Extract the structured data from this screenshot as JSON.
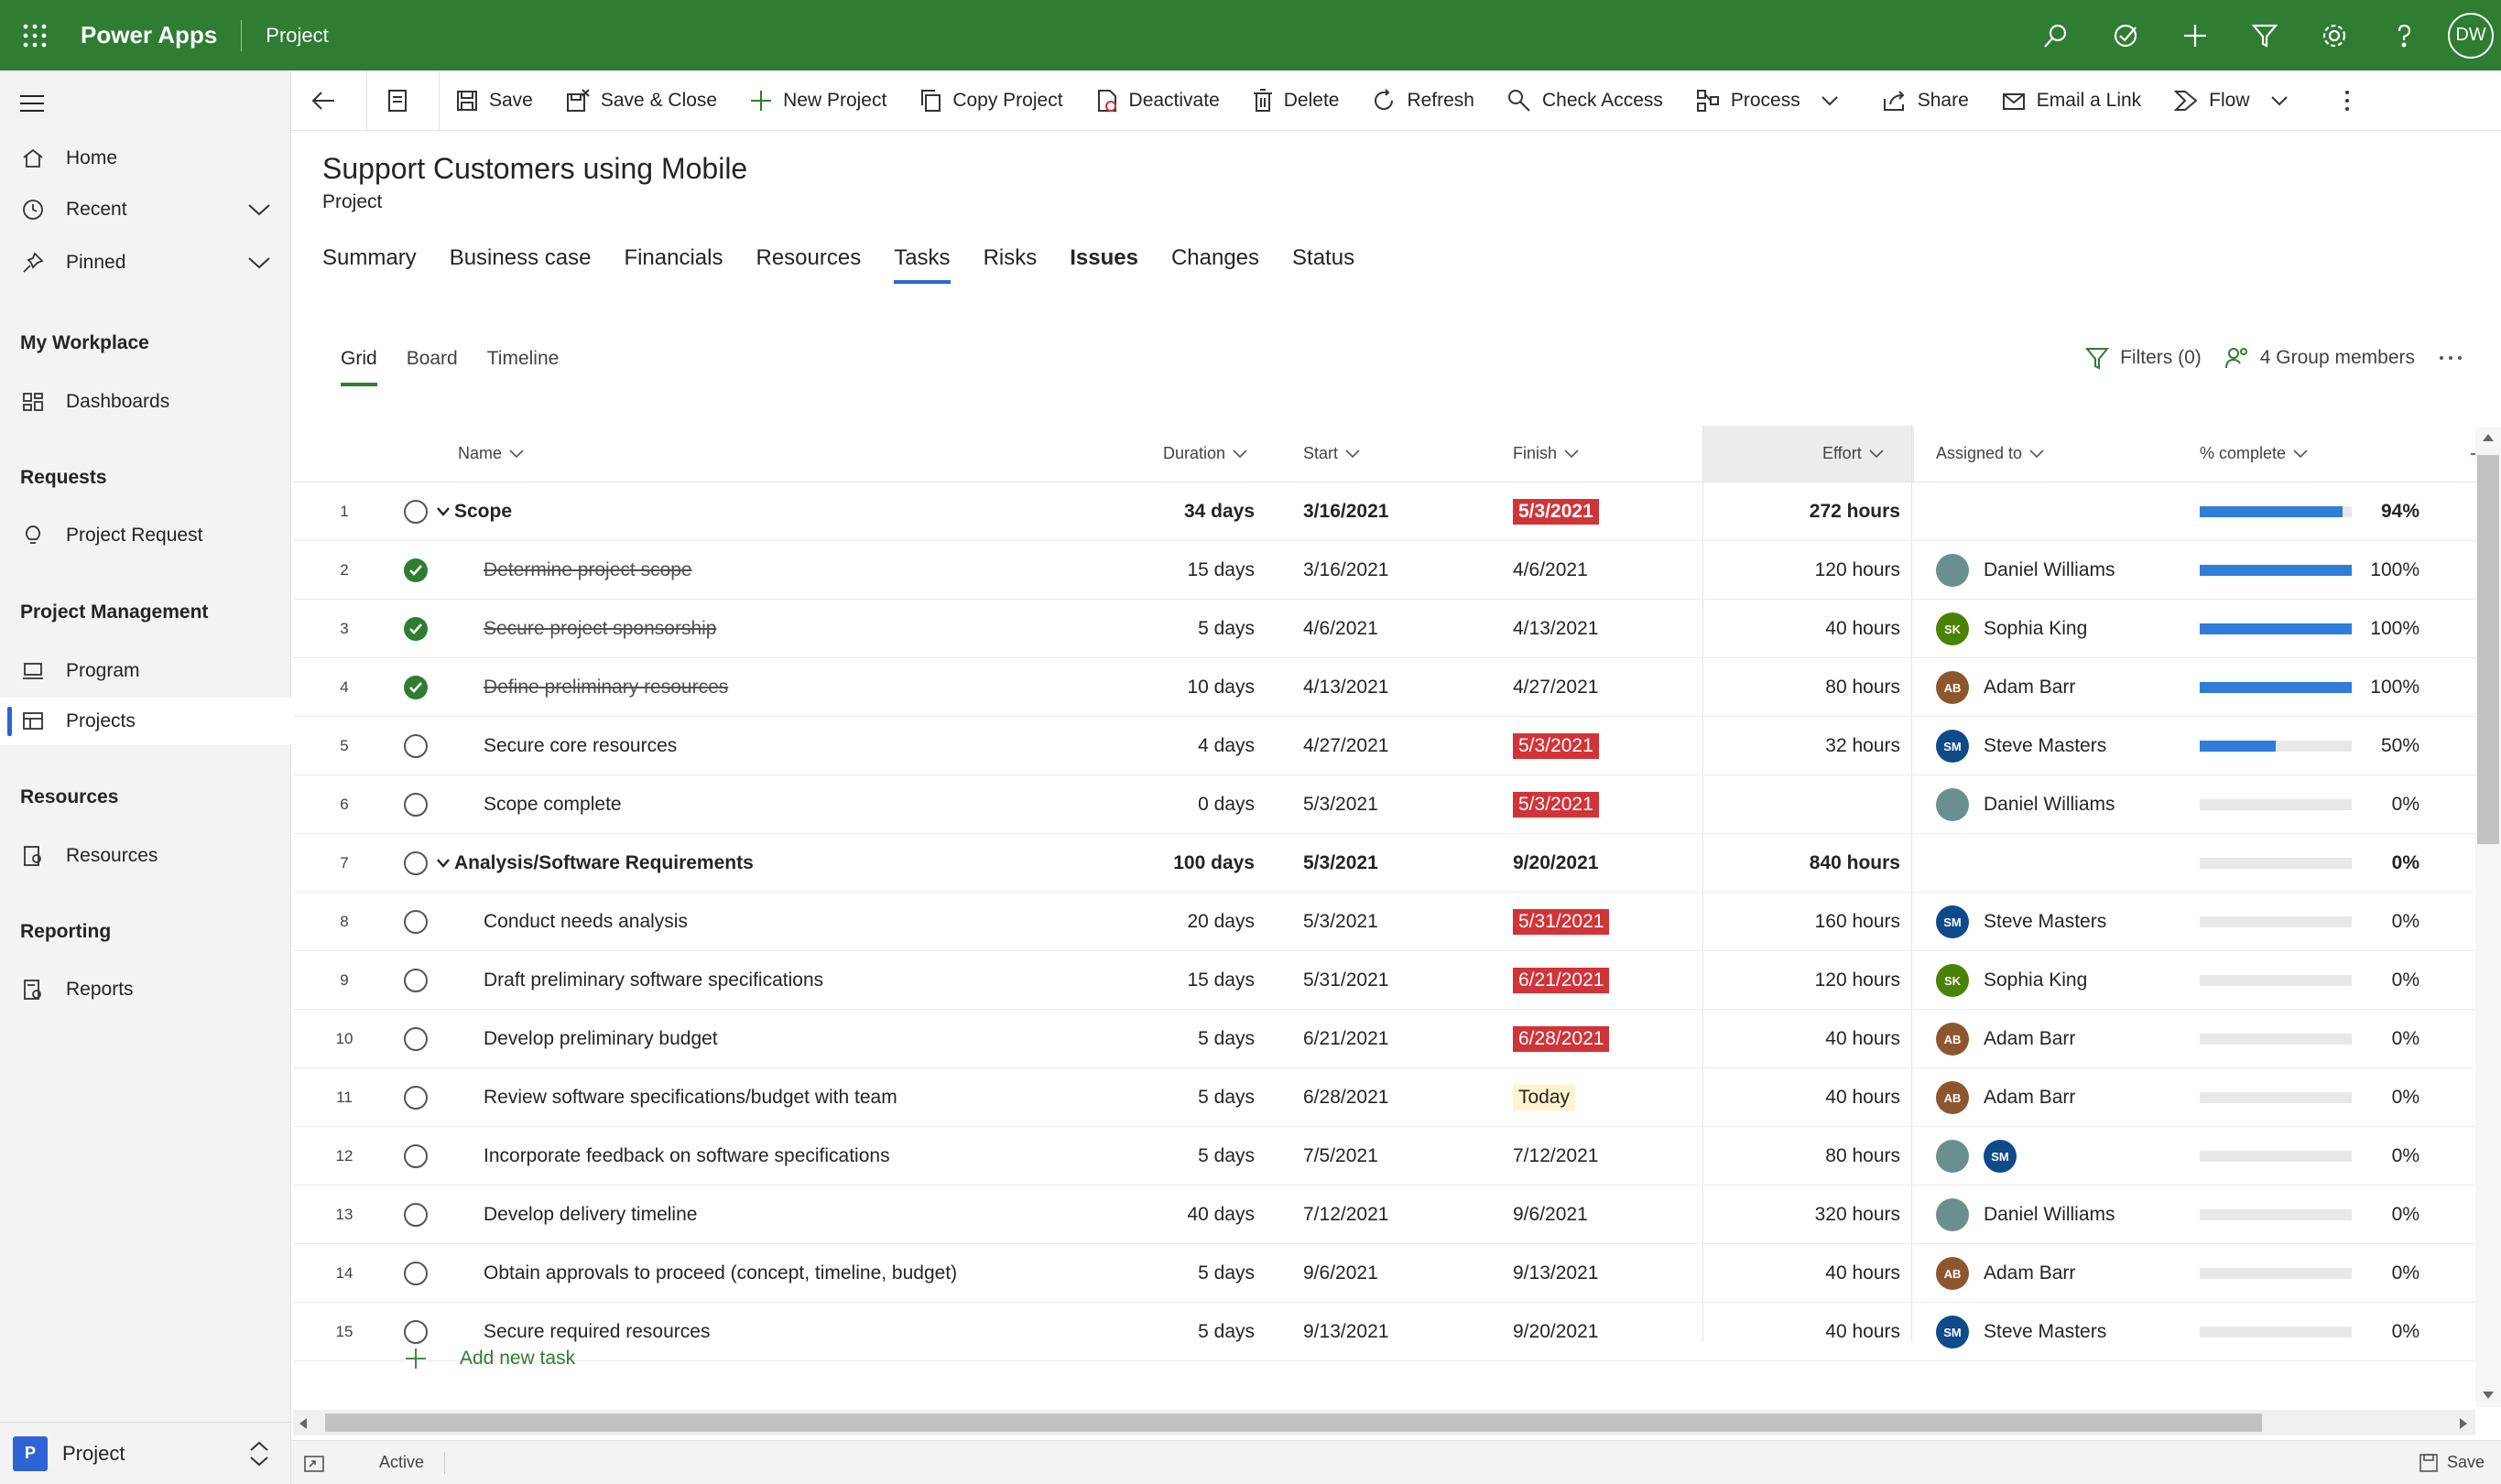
{
  "topbar": {
    "app_name": "Power Apps",
    "area": "Project",
    "user_initials": "DW",
    "icons": [
      "search-icon",
      "task-check-icon",
      "plus-icon",
      "filter-icon",
      "settings-icon",
      "help-icon"
    ]
  },
  "sidebar": {
    "home": "Home",
    "recent": "Recent",
    "pinned": "Pinned",
    "groups": {
      "my_workplace": "My Workplace",
      "requests": "Requests",
      "project_management": "Project Management",
      "resources": "Resources",
      "reporting": "Reporting"
    },
    "items": {
      "dashboards": "Dashboards",
      "project_request": "Project Request",
      "program": "Program",
      "projects": "Projects",
      "resources": "Resources",
      "reports": "Reports"
    },
    "area_switcher": {
      "badge": "P",
      "label": "Project"
    }
  },
  "commandbar": {
    "save": "Save",
    "save_close": "Save & Close",
    "new_project": "New Project",
    "copy_project": "Copy Project",
    "deactivate": "Deactivate",
    "delete": "Delete",
    "refresh": "Refresh",
    "check_access": "Check Access",
    "process": "Process",
    "share": "Share",
    "email_link": "Email a Link",
    "flow": "Flow"
  },
  "record": {
    "title": "Support Customers using Mobile",
    "entity": "Project",
    "tabs": [
      "Summary",
      "Business case",
      "Financials",
      "Resources",
      "Tasks",
      "Risks",
      "Issues",
      "Changes",
      "Status"
    ],
    "active_tab": "Tasks"
  },
  "view": {
    "tabs": [
      "Grid",
      "Board",
      "Timeline"
    ],
    "active": "Grid",
    "filters": "Filters (0)",
    "group_members": "4 Group members"
  },
  "grid": {
    "columns": {
      "name": "Name",
      "duration": "Duration",
      "start": "Start",
      "finish": "Finish",
      "effort": "Effort",
      "assigned": "Assigned to",
      "pct": "% complete"
    },
    "rows": [
      {
        "n": "1",
        "name": "Scope",
        "summary": true,
        "done": false,
        "dur": "34 days",
        "start": "3/16/2021",
        "finish": "5/3/2021",
        "finish_state": "late",
        "effort": "272 hours",
        "assigned": [],
        "pct": 94
      },
      {
        "n": "2",
        "name": "Determine project scope",
        "done": true,
        "dur": "15 days",
        "start": "3/16/2021",
        "finish": "4/6/2021",
        "finish_state": "",
        "effort": "120 hours",
        "assigned": [
          {
            "name": "Daniel Williams",
            "initials": "",
            "color": "photo"
          }
        ],
        "pct": 100
      },
      {
        "n": "3",
        "name": "Secure project sponsorship",
        "done": true,
        "dur": "5 days",
        "start": "4/6/2021",
        "finish": "4/13/2021",
        "finish_state": "",
        "effort": "40 hours",
        "assigned": [
          {
            "name": "Sophia King",
            "initials": "SK",
            "color": "#498205"
          }
        ],
        "pct": 100
      },
      {
        "n": "4",
        "name": "Define preliminary resources",
        "done": true,
        "dur": "10 days",
        "start": "4/13/2021",
        "finish": "4/27/2021",
        "finish_state": "",
        "effort": "80 hours",
        "assigned": [
          {
            "name": "Adam Barr",
            "initials": "AB",
            "color": "#8e562e"
          }
        ],
        "pct": 100
      },
      {
        "n": "5",
        "name": "Secure core resources",
        "done": false,
        "dur": "4 days",
        "start": "4/27/2021",
        "finish": "5/3/2021",
        "finish_state": "late",
        "effort": "32 hours",
        "assigned": [
          {
            "name": "Steve Masters",
            "initials": "SM",
            "color": "#0f4a8a"
          }
        ],
        "pct": 50
      },
      {
        "n": "6",
        "name": "Scope complete",
        "done": false,
        "dur": "0 days",
        "start": "5/3/2021",
        "finish": "5/3/2021",
        "finish_state": "late",
        "effort": "",
        "assigned": [
          {
            "name": "Daniel Williams",
            "initials": "",
            "color": "photo"
          }
        ],
        "pct": 0
      },
      {
        "n": "7",
        "name": "Analysis/Software Requirements",
        "summary": true,
        "done": false,
        "dur": "100 days",
        "start": "5/3/2021",
        "finish": "9/20/2021",
        "finish_state": "",
        "effort": "840 hours",
        "assigned": [],
        "pct": 0
      },
      {
        "n": "8",
        "name": "Conduct needs analysis",
        "done": false,
        "dur": "20 days",
        "start": "5/3/2021",
        "finish": "5/31/2021",
        "finish_state": "late",
        "effort": "160 hours",
        "assigned": [
          {
            "name": "Steve Masters",
            "initials": "SM",
            "color": "#0f4a8a"
          }
        ],
        "pct": 0
      },
      {
        "n": "9",
        "name": "Draft preliminary software specifications",
        "done": false,
        "dur": "15 days",
        "start": "5/31/2021",
        "finish": "6/21/2021",
        "finish_state": "late",
        "effort": "120 hours",
        "assigned": [
          {
            "name": "Sophia King",
            "initials": "SK",
            "color": "#498205"
          }
        ],
        "pct": 0
      },
      {
        "n": "10",
        "name": "Develop preliminary budget",
        "done": false,
        "dur": "5 days",
        "start": "6/21/2021",
        "finish": "6/28/2021",
        "finish_state": "late",
        "effort": "40 hours",
        "assigned": [
          {
            "name": "Adam Barr",
            "initials": "AB",
            "color": "#8e562e"
          }
        ],
        "pct": 0
      },
      {
        "n": "11",
        "name": "Review software specifications/budget with team",
        "done": false,
        "dur": "5 days",
        "start": "6/28/2021",
        "finish": "Today",
        "finish_state": "today",
        "effort": "40 hours",
        "assigned": [
          {
            "name": "Adam Barr",
            "initials": "AB",
            "color": "#8e562e"
          }
        ],
        "pct": 0
      },
      {
        "n": "12",
        "name": "Incorporate feedback on software specifications",
        "done": false,
        "dur": "5 days",
        "start": "7/5/2021",
        "finish": "7/12/2021",
        "finish_state": "",
        "effort": "80 hours",
        "assigned": [
          {
            "name": "",
            "initials": "",
            "color": "photo"
          },
          {
            "name": "",
            "initials": "SM",
            "color": "#0f4a8a"
          }
        ],
        "pct": 0
      },
      {
        "n": "13",
        "name": "Develop delivery timeline",
        "done": false,
        "dur": "40 days",
        "start": "7/12/2021",
        "finish": "9/6/2021",
        "finish_state": "",
        "effort": "320 hours",
        "assigned": [
          {
            "name": "Daniel Williams",
            "initials": "",
            "color": "photo"
          }
        ],
        "pct": 0
      },
      {
        "n": "14",
        "name": "Obtain approvals to proceed (concept, timeline, budget)",
        "done": false,
        "dur": "5 days",
        "start": "9/6/2021",
        "finish": "9/13/2021",
        "finish_state": "",
        "effort": "40 hours",
        "assigned": [
          {
            "name": "Adam Barr",
            "initials": "AB",
            "color": "#8e562e"
          }
        ],
        "pct": 0
      },
      {
        "n": "15",
        "name": "Secure required resources",
        "done": false,
        "dur": "5 days",
        "start": "9/13/2021",
        "finish": "9/20/2021",
        "finish_state": "",
        "effort": "40 hours",
        "assigned": [
          {
            "name": "Steve Masters",
            "initials": "SM",
            "color": "#0f4a8a"
          }
        ],
        "pct": 0
      }
    ],
    "add_task": "Add new task"
  },
  "footer": {
    "status": "Active",
    "save": "Save"
  },
  "colors": {
    "brand": "#2e7d32",
    "accent": "#2e63d6",
    "late": "#d13438",
    "progress": "#2f7dd8"
  }
}
